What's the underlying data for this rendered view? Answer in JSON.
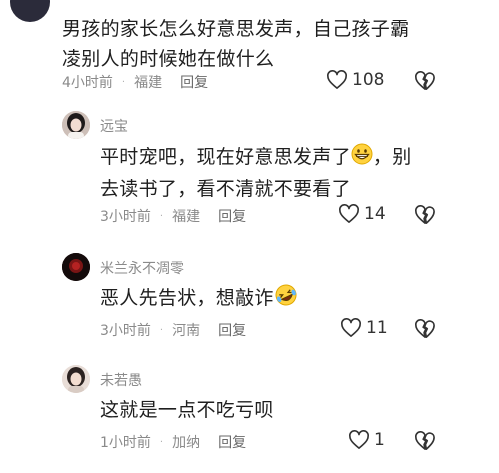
{
  "top_comment": {
    "username": "",
    "text_line1": "男孩的家长怎么好意思发声，自己孩子霸",
    "text_line2": "凌别人的时候她在做什么",
    "time": "4小时前",
    "location": "福建",
    "reply_label": "回复",
    "likes": "108"
  },
  "replies": [
    {
      "username": "远宝",
      "text_line1_a": "平时宠吧，现在好意思发声了",
      "emoji1": "grinning-face",
      "text_line1_b": "，别",
      "text_line2": "去读书了，看不清就不要看了",
      "time": "3小时前",
      "location": "福建",
      "reply_label": "回复",
      "likes": "14"
    },
    {
      "username": "米兰永不凋零",
      "text": "恶人先告状，想敲诈",
      "emoji": "rolling-laughing-face",
      "time": "3小时前",
      "location": "河南",
      "reply_label": "回复",
      "likes": "11"
    },
    {
      "username": "未若愚",
      "text": "这就是一点不吃亏呗",
      "time": "1小时前",
      "location": "加纳",
      "reply_label": "回复",
      "likes": "1"
    }
  ]
}
